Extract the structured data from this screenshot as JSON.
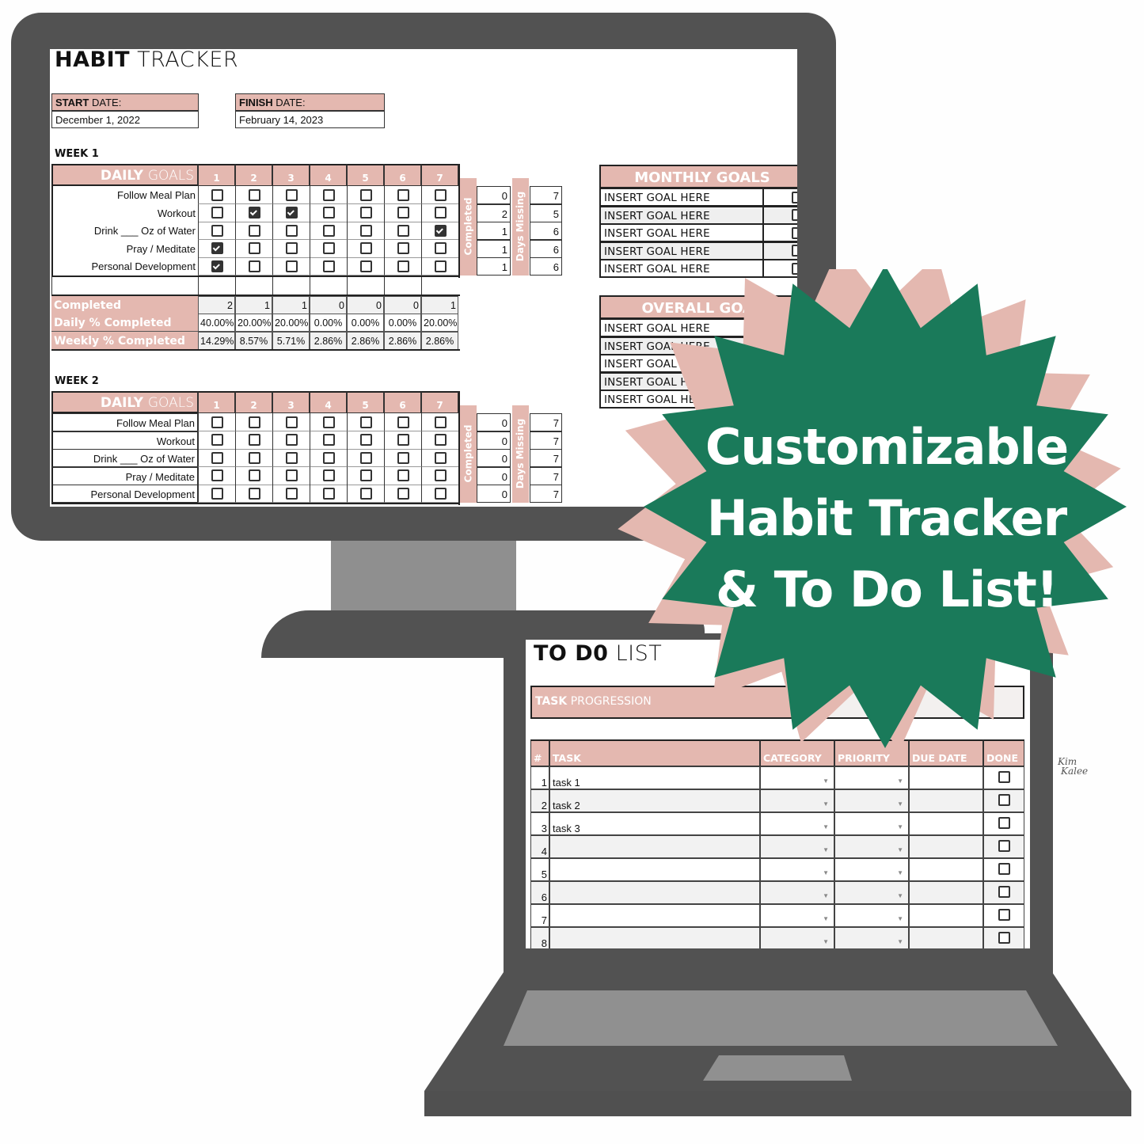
{
  "habit_tracker": {
    "title_bold": "HABIT",
    "title_light": "TRACKER",
    "start_date": {
      "label_bold": "START",
      "label_light": "DATE:",
      "value": "December 1, 2022"
    },
    "finish_date": {
      "label_bold": "FINISH",
      "label_light": "DATE:",
      "value": "February 14, 2023"
    },
    "weeks": [
      {
        "label": "WEEK 1",
        "header_bold": "DAILY",
        "header_light": "GOALS",
        "days": [
          "1",
          "2",
          "3",
          "4",
          "5",
          "6",
          "7"
        ],
        "completed_label": "Completed",
        "days_missing_label": "Days Missing",
        "habits": [
          {
            "name": "Follow Meal Plan",
            "checks": [
              false,
              false,
              false,
              false,
              false,
              false,
              false
            ],
            "completed": "0",
            "missing": "7"
          },
          {
            "name": "Workout",
            "checks": [
              false,
              true,
              true,
              false,
              false,
              false,
              false
            ],
            "completed": "2",
            "missing": "5"
          },
          {
            "name": "Drink ___ Oz of Water",
            "checks": [
              false,
              false,
              false,
              false,
              false,
              false,
              true
            ],
            "completed": "1",
            "missing": "6"
          },
          {
            "name": "Pray / Meditate",
            "checks": [
              true,
              false,
              false,
              false,
              false,
              false,
              false
            ],
            "completed": "1",
            "missing": "6"
          },
          {
            "name": "Personal Development",
            "checks": [
              true,
              false,
              false,
              false,
              false,
              false,
              false
            ],
            "completed": "1",
            "missing": "6"
          }
        ],
        "summary": [
          {
            "label": "Completed",
            "values": [
              "2",
              "1",
              "1",
              "0",
              "0",
              "0",
              "1"
            ]
          },
          {
            "label": "Daily % Completed",
            "values": [
              "40.00%",
              "20.00%",
              "20.00%",
              "0.00%",
              "0.00%",
              "0.00%",
              "20.00%"
            ]
          },
          {
            "label": "Weekly % Completed",
            "values": [
              "14.29%",
              "8.57%",
              "5.71%",
              "2.86%",
              "2.86%",
              "2.86%",
              "2.86%"
            ]
          }
        ]
      },
      {
        "label": "WEEK 2",
        "header_bold": "DAILY",
        "header_light": "GOALS",
        "days": [
          "1",
          "2",
          "3",
          "4",
          "5",
          "6",
          "7"
        ],
        "completed_label": "Completed",
        "days_missing_label": "Days Missing",
        "habits": [
          {
            "name": "Follow Meal Plan",
            "checks": [
              false,
              false,
              false,
              false,
              false,
              false,
              false
            ],
            "completed": "0",
            "missing": "7"
          },
          {
            "name": "Workout",
            "checks": [
              false,
              false,
              false,
              false,
              false,
              false,
              false
            ],
            "completed": "0",
            "missing": "7"
          },
          {
            "name": "Drink ___ Oz of Water",
            "checks": [
              false,
              false,
              false,
              false,
              false,
              false,
              false
            ],
            "completed": "0",
            "missing": "7"
          },
          {
            "name": "Pray / Meditate",
            "checks": [
              false,
              false,
              false,
              false,
              false,
              false,
              false
            ],
            "completed": "0",
            "missing": "7"
          },
          {
            "name": "Personal Development",
            "checks": [
              false,
              false,
              false,
              false,
              false,
              false,
              false
            ],
            "completed": "0",
            "missing": "7"
          }
        ]
      }
    ],
    "monthly_goals": {
      "title": "MONTHLY GOALS",
      "items": [
        "INSERT GOAL HERE",
        "INSERT GOAL HERE",
        "INSERT GOAL HERE",
        "INSERT GOAL HERE",
        "INSERT GOAL HERE"
      ]
    },
    "overall_goals": {
      "title": "OVERALL GOAL",
      "items": [
        "INSERT GOAL HERE",
        "INSERT GOAL HERE",
        "INSERT GOAL HERE",
        "INSERT GOAL HERE",
        "INSERT GOAL HERE"
      ]
    }
  },
  "todo_list": {
    "title_bold": "TO D0",
    "title_light": "LIST",
    "progression_bold": "TASK",
    "progression_light": "PROGRESSION",
    "columns": [
      "#",
      "TASK",
      "CATEGORY",
      "PRIORITY",
      "DUE DATE",
      "DONE"
    ],
    "rows": [
      {
        "num": "1",
        "task": "task 1",
        "done": false
      },
      {
        "num": "2",
        "task": "task 2",
        "done": false
      },
      {
        "num": "3",
        "task": "task 3",
        "done": false
      },
      {
        "num": "4",
        "task": "",
        "done": false
      },
      {
        "num": "5",
        "task": "",
        "done": false
      },
      {
        "num": "6",
        "task": "",
        "done": false
      },
      {
        "num": "7",
        "task": "",
        "done": false
      },
      {
        "num": "8",
        "task": "",
        "done": false
      }
    ]
  },
  "badge": {
    "lines": [
      "Customizable",
      "Habit Tracker",
      "& To Do List!"
    ],
    "color": "#1a7a5a",
    "shadow_color": "#e4b8b0"
  },
  "logo": {
    "line1": "Kim",
    "line2": "Kalee"
  },
  "colors": {
    "accent_pink": "#e4b8b0",
    "device_dark": "#525252",
    "device_light": "#8f8f8f"
  }
}
